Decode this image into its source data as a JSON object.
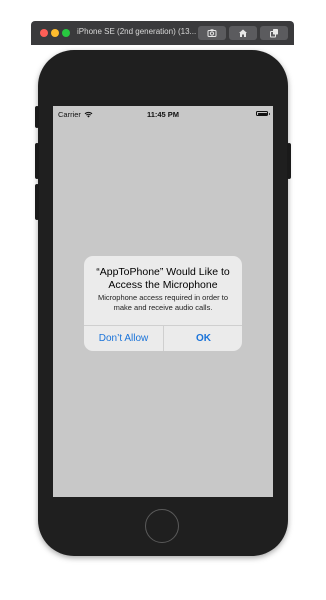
{
  "toolbar": {
    "title": "iPhone SE (2nd generation) (13...",
    "buttons": [
      {
        "name": "screenshot",
        "icon": "camera-icon"
      },
      {
        "name": "home",
        "icon": "home-icon"
      },
      {
        "name": "rotate",
        "icon": "rotate-icon"
      }
    ],
    "traffic_colors": {
      "close": "#fe5f57",
      "minimize": "#febc2e",
      "zoom": "#28c840"
    }
  },
  "statusbar": {
    "carrier": "Carrier",
    "time": "11:45 PM",
    "wifi_icon": "wifi-icon",
    "battery_icon": "battery-icon"
  },
  "alert": {
    "title": "“AppToPhone” Would Like to Access the Microphone",
    "message": "Microphone access required in order to make and receive audio calls.",
    "deny_label": "Don’t Allow",
    "ok_label": "OK",
    "button_color": "#1a73d9"
  },
  "colors": {
    "screen_background": "#c8c8c8",
    "device_body": "#1f1f1f"
  }
}
